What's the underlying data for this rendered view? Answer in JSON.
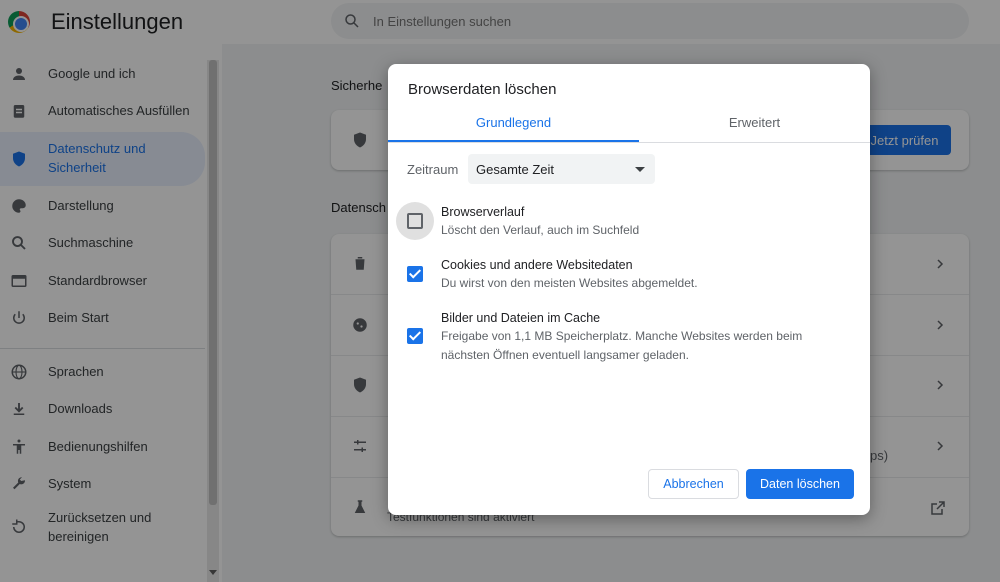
{
  "app": {
    "title": "Einstellungen"
  },
  "search": {
    "placeholder": "In Einstellungen suchen"
  },
  "sidebar": {
    "items": [
      {
        "label": "Google und ich",
        "icon": "person-icon"
      },
      {
        "label": "Automatisches Ausfüllen",
        "icon": "clipboard-icon"
      },
      {
        "label": "Datenschutz und Sicherheit",
        "icon": "shield-icon",
        "active": true
      },
      {
        "label": "Darstellung",
        "icon": "palette-icon"
      },
      {
        "label": "Suchmaschine",
        "icon": "search-icon"
      },
      {
        "label": "Standardbrowser",
        "icon": "browser-icon"
      },
      {
        "label": "Beim Start",
        "icon": "power-icon"
      },
      {
        "label": "Sprachen",
        "icon": "globe-icon"
      },
      {
        "label": "Downloads",
        "icon": "download-icon"
      },
      {
        "label": "Bedienungshilfen",
        "icon": "accessibility-icon"
      },
      {
        "label": "System",
        "icon": "wrench-icon"
      },
      {
        "label": "Zurücksetzen und bereinigen",
        "icon": "reset-icon"
      }
    ]
  },
  "main": {
    "safety_heading": "Sicherhe",
    "privacy_heading": "Datensch",
    "check_now_label": "Jetzt prüfen",
    "row_fragments": [
      "ps)",
      "Testfunktionen sind aktiviert"
    ]
  },
  "dialog": {
    "title": "Browserdaten löschen",
    "tabs": {
      "basic": "Grundlegend",
      "advanced": "Erweitert"
    },
    "time_range": {
      "label": "Zeitraum",
      "value": "Gesamte Zeit"
    },
    "options": [
      {
        "title": "Browserverlauf",
        "desc": "Löscht den Verlauf, auch im Suchfeld",
        "checked": false
      },
      {
        "title": "Cookies und andere Websitedaten",
        "desc": "Du wirst von den meisten Websites abgemeldet.",
        "checked": true
      },
      {
        "title": "Bilder und Dateien im Cache",
        "desc": "Freigabe von 1,1 MB Speicherplatz. Manche Websites werden beim nächsten Öffnen eventuell langsamer geladen.",
        "checked": true
      }
    ],
    "cancel_label": "Abbrechen",
    "delete_label": "Daten löschen"
  },
  "colors": {
    "accent": "#1a73e8",
    "overlay": "rgba(0,0,0,0.42)"
  }
}
